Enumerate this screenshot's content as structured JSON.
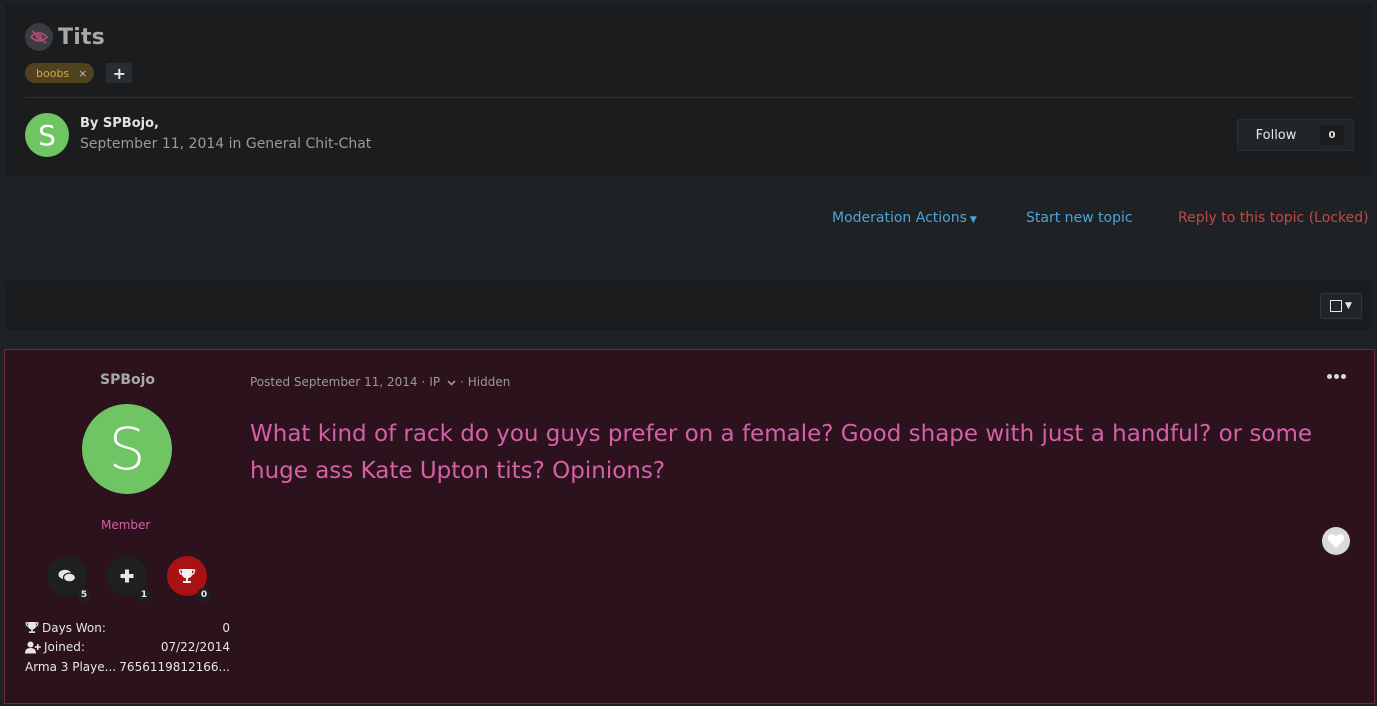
{
  "topic": {
    "title": "Tits",
    "status_icon": "hidden-eye-icon",
    "tags": [
      {
        "label": "boobs",
        "remove_glyph": "×"
      }
    ],
    "add_tag_glyph": "+",
    "author": {
      "avatar_letter": "S",
      "byline": "By SPBojo,",
      "meta": "September 11, 2014 in General Chit-Chat"
    },
    "follow": {
      "label": "Follow",
      "count": "0"
    }
  },
  "actions": {
    "moderation": "Moderation Actions",
    "start_topic": "Start new topic",
    "reply": "Reply to this topic (Locked)"
  },
  "colors": {
    "accent_blue": "#4ea3d9",
    "locked_red": "#c54848",
    "hidden_post_bg": "#2b121d",
    "post_text_pink": "#d660a8",
    "avatar_green": "#6fc464"
  },
  "post": {
    "author_name": "SPBojo",
    "avatar_letter": "S",
    "group": "Member",
    "badges": [
      {
        "icon": "comments-icon",
        "count": "5"
      },
      {
        "icon": "plus-icon",
        "count": "1"
      },
      {
        "icon": "trophy-icon",
        "count": "0"
      }
    ],
    "stats": [
      {
        "icon": "trophy-icon",
        "label": "Days Won:",
        "value": "0"
      },
      {
        "icon": "user-plus-icon",
        "label": "Joined:",
        "value": "07/22/2014"
      },
      {
        "icon": "",
        "label": "Arma 3 Playe...",
        "value": "7656119812166..."
      }
    ],
    "meta": {
      "posted": "Posted September 11, 2014",
      "sep": "·",
      "ip": "IP",
      "status": "Hidden"
    },
    "body": "What kind of rack do you guys prefer on a female? Good shape with just a handful? or some huge ass Kate Upton tits? Opinions?"
  }
}
